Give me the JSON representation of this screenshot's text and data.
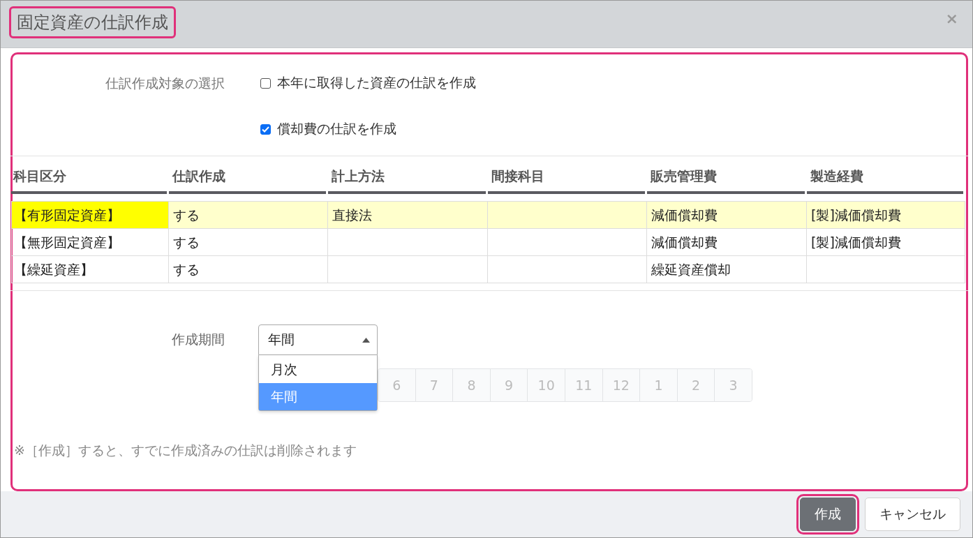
{
  "dialog": {
    "title": "固定資産の仕訳作成",
    "title_annotated": true,
    "close": "×",
    "body_annotated": true
  },
  "target": {
    "label": "仕訳作成対象の選択",
    "options": [
      {
        "label": "本年に取得した資産の仕訳を作成",
        "checked": false
      },
      {
        "label": "償却費の仕訳を作成",
        "checked": true
      }
    ]
  },
  "table": {
    "columns": [
      "科目区分",
      "仕訳作成",
      "計上方法",
      "間接科目",
      "販売管理費",
      "製造経費"
    ],
    "rows": [
      {
        "cells": [
          "【有形固定資産】",
          "する",
          "直接法",
          null,
          "減価償却費",
          "[製]減価償却費"
        ],
        "selected": true
      },
      {
        "cells": [
          "【無形固定資産】",
          "する",
          null,
          null,
          "減価償却費",
          "[製]減価償却費"
        ],
        "selected": false
      },
      {
        "cells": [
          "【繰延資産】",
          "する",
          null,
          null,
          "繰延資産償却",
          null
        ],
        "selected": false
      }
    ]
  },
  "period": {
    "label": "作成期間",
    "value": "年間",
    "expanded": true,
    "options": [
      {
        "label": "月次",
        "selected": false
      },
      {
        "label": "年間",
        "selected": true
      }
    ]
  },
  "months": [
    {
      "label": "6",
      "disabled": true
    },
    {
      "label": "7",
      "disabled": true
    },
    {
      "label": "8",
      "disabled": true
    },
    {
      "label": "9",
      "disabled": true
    },
    {
      "label": "10",
      "disabled": true
    },
    {
      "label": "11",
      "disabled": true
    },
    {
      "label": "12",
      "disabled": true
    },
    {
      "label": "1",
      "disabled": true
    },
    {
      "label": "2",
      "disabled": true
    },
    {
      "label": "3",
      "disabled": true
    }
  ],
  "note": "※［作成］すると、すでに作成済みの仕訳は削除されます",
  "buttons": [
    {
      "label": "作成",
      "kind": "primary",
      "annotated": true
    },
    {
      "label": "キャンセル",
      "kind": "secondary",
      "annotated": false
    }
  ]
}
